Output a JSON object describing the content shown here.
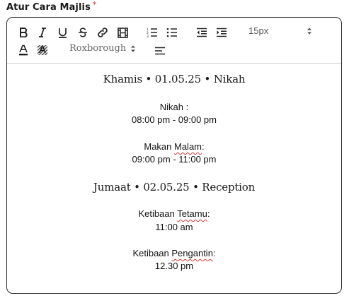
{
  "field": {
    "label": "Atur Cara Majlis",
    "required_mark": "*"
  },
  "toolbar": {
    "bold_icon": "bold-icon",
    "italic_icon": "italic-icon",
    "underline_icon": "underline-icon",
    "strike_icon": "strikethrough-icon",
    "link_icon": "link-icon",
    "video_icon": "film-icon",
    "ordered_list_icon": "ordered-list-icon",
    "bullet_list_icon": "bullet-list-icon",
    "outdent_icon": "outdent-icon",
    "indent_icon": "indent-icon",
    "font_size": "15px",
    "font_family": "Roxborough",
    "text_color_icon": "text-color-icon",
    "highlight_icon": "highlight-icon",
    "align_icon": "align-icon"
  },
  "content": {
    "day1_heading": "Khamis • 01.05.25 • Nikah",
    "item1_title": "Nikah :",
    "item1_time": "08:00 pm - 09:00 pm",
    "item2_title_pre": "Makan ",
    "item2_title_err": "Malam",
    "item2_title_post": ":",
    "item2_time": "09:00 pm - 11:00 pm",
    "day2_heading": "Jumaat • 02.05.25 • Reception",
    "item3_title_pre": "Ketibaan ",
    "item3_title_err": "Tetamu",
    "item3_title_post": ":",
    "item3_time": "11:00 am",
    "item4_title_pre": "Ketibaan ",
    "item4_title_err": "Pengantin",
    "item4_title_post": ":",
    "item4_time": "12.30 pm"
  },
  "colors": {
    "required": "#e0303a",
    "spellcheck": "#e03a3a",
    "border": "#2b2b2b"
  }
}
